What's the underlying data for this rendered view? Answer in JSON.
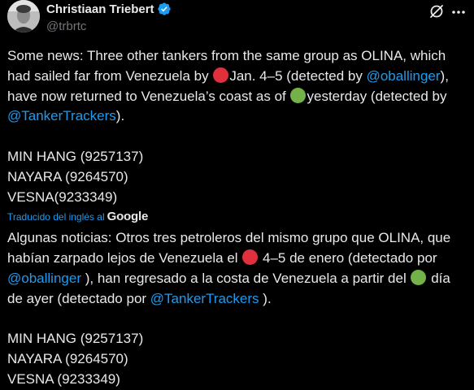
{
  "author": {
    "display_name": "Christiaan Triebert",
    "handle": "@trbrtc",
    "verified": true
  },
  "icons": {
    "verified": "verified-badge-icon",
    "grok": "grok-slash-icon",
    "more": "more-dots-icon",
    "red_dot": "red-circle-emoji",
    "green_dot": "green-circle-emoji"
  },
  "colors": {
    "link": "#1d9bf0",
    "red_dot": "#e0303e",
    "green_dot": "#73b248"
  },
  "original": {
    "p1_a": "Some news: Three other tankers from the same group as OLINA, which had sailed far from Venezuela by ",
    "p1_b": "Jan. 4–5 (detected by ",
    "mention_1": "@oballinger",
    "p1_c": "), have now returned to Venezuela’s coast as of ",
    "p1_d": "yesterday (detected by ",
    "mention_2": "@TankerTrackers",
    "p1_e": ").",
    "ships": [
      "MIN HANG (9257137)",
      "NAYARA (9264570)",
      "VESNA(9233349)"
    ]
  },
  "translation": {
    "label": "Traducido del inglés al",
    "provider": "Google",
    "p1_a": "Algunas noticias: Otros tres petroleros del mismo grupo que OLINA, que habían zarpado lejos de Venezuela el ",
    "p1_b": " 4–5 de enero (detectado por ",
    "mention_1": "@oballinger",
    "p1_c": " ), han regresado a la costa de Venezuela a partir del ",
    "p1_d": " día de ayer (detectado por ",
    "mention_2": "@TankerTrackers",
    "p1_e": " ).",
    "ships": [
      "MIN HANG (9257137)",
      "NAYARA (9264570)",
      "VESNA (9233349)"
    ]
  }
}
